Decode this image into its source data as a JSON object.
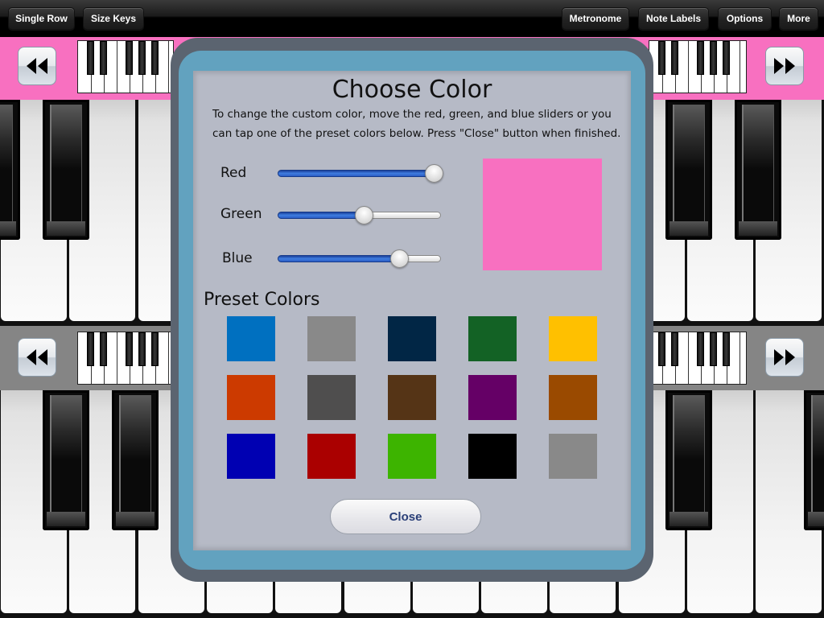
{
  "toolbar": {
    "left_buttons": [
      {
        "label": "Single Row"
      },
      {
        "label": "Size Keys"
      }
    ],
    "right_buttons": [
      {
        "label": "Metronome"
      },
      {
        "label": "Note Labels"
      },
      {
        "label": "Options"
      },
      {
        "label": "More"
      }
    ]
  },
  "keyboards": {
    "top_strip_color": "#f870c0",
    "bottom_strip_color": "#858585",
    "rewind_icon": "rewind-icon",
    "forward_icon": "fast-forward-icon"
  },
  "dialog": {
    "title": "Choose Color",
    "description": "To change the custom color, move the red, green, and blue sliders or you can tap one of the preset colors below. Press \"Close\" button when finished.",
    "sliders": [
      {
        "label": "Red",
        "value": 1.0
      },
      {
        "label": "Green",
        "value": 0.53
      },
      {
        "label": "Blue",
        "value": 0.77
      }
    ],
    "current_color": "#f870c0",
    "preset_title": "Preset Colors",
    "presets": [
      "#0070c0",
      "#898989",
      "#012645",
      "#136225",
      "#ffc000",
      "#cc3a00",
      "#4f4e4e",
      "#553416",
      "#650066",
      "#9a4a00",
      "#0000b2",
      "#aa0000",
      "#3db400",
      "#000000",
      "#898989"
    ],
    "close_label": "Close"
  }
}
